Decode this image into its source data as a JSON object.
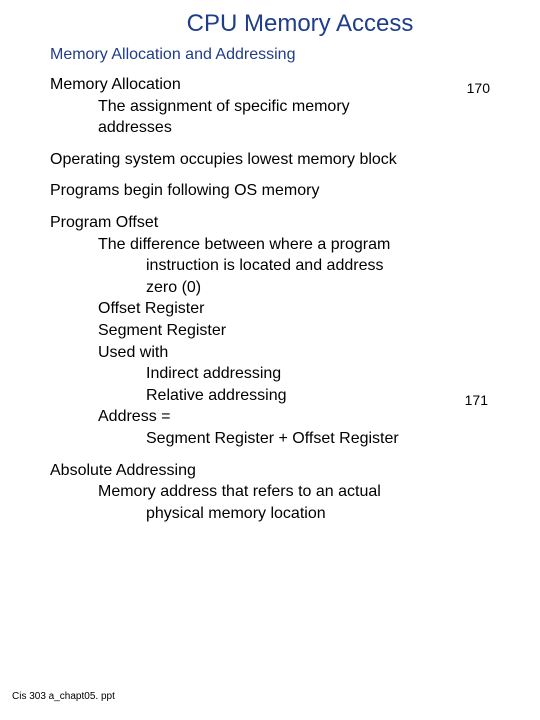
{
  "title": "CPU Memory Access",
  "subtitle": "Memory Allocation and Addressing",
  "page1": "170",
  "page2": "171",
  "sec1": {
    "h": "Memory Allocation",
    "l1": "The assignment of specific memory",
    "l2": "addresses"
  },
  "line_os": "Operating system occupies lowest memory block",
  "line_prog": "Programs begin following OS memory",
  "sec2": {
    "h": "Program Offset",
    "l1": "The difference between where a program",
    "l2": "instruction is located and address",
    "l3": "zero (0)",
    "l4": "Offset Register",
    "l5": "Segment Register",
    "l6": "Used with",
    "l7": "Indirect addressing",
    "l8": "Relative addressing",
    "l9": "Address =",
    "l10": "Segment Register + Offset Register"
  },
  "sec3": {
    "h": "Absolute Addressing",
    "l1": "Memory address that refers to an actual",
    "l2": "physical memory location"
  },
  "footer": "Cis 303 a_chapt05. ppt"
}
